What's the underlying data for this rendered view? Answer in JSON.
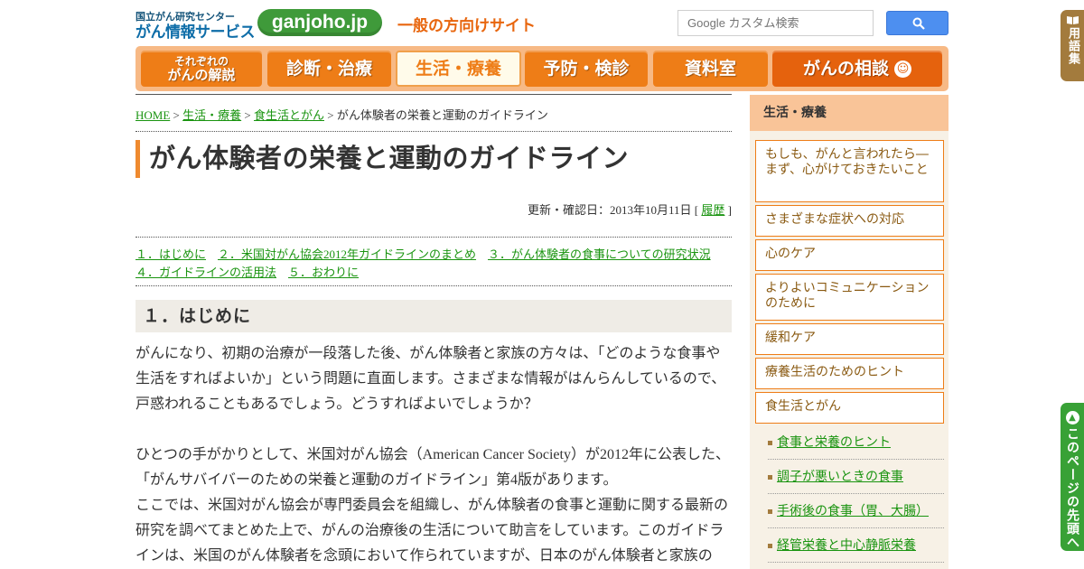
{
  "header": {
    "logo_small": "国立がん研究センター",
    "logo_big": "がん情報サービス",
    "logo_pill": "ganjoho.jp",
    "tagline": "一般の方向けサイト",
    "search_placeholder": "Google カスタム検索",
    "glossary": "用語集"
  },
  "nav": {
    "item1_small": "それぞれの",
    "item1_main": "がんの解説",
    "item2": "診断・治療",
    "item3": "生活・療養",
    "item4": "予防・検診",
    "item5": "資料室",
    "item6": "がんの相談"
  },
  "breadcrumb": {
    "home": "HOME",
    "sep1": " > ",
    "level1": "生活・療養",
    "sep2": " > ",
    "level2": "食生活とがん",
    "sep3": " > ",
    "current": "がん体験者の栄養と運動のガイドライン"
  },
  "page": {
    "title": "がん体験者の栄養と運動のガイドライン",
    "updated_prefix": "更新・確認日：2013年10月11日 [ ",
    "history_link": "履歴",
    "updated_suffix": " ]"
  },
  "toc": [
    "１．はじめに",
    "２．米国対がん協会2012年ガイドラインのまとめ",
    "３．がん体験者の食事についての研究状況",
    "４．ガイドラインの活用法",
    "５．おわりに"
  ],
  "section1": {
    "heading": "１．はじめに",
    "para1": "がんになり、初期の治療が一段落した後、がん体験者と家族の方々は、「どのような食事や生活をすればよいか」という問題に直面します。さまざまな情報がはんらんしているので、戸惑われることもあるでしょう。どうすればよいでしょうか？",
    "para2": "ひとつの手がかりとして、米国対がん協会（American Cancer Society）が2012年に公表した、「がんサバイバーのための栄養と運動のガイドライン」第4版があります。",
    "para3": "ここでは、米国対がん協会が専門委員会を組織し、がん体験者の食事と運動に関する最新の研究を調べてまとめた上で、がんの治療後の生活について助言をしています。このガイドラインは、米国のがん体験者を念頭において作られていますが、日本のがん体験者と家族の"
  },
  "sidebar": {
    "heading": "生活・療養",
    "items": [
      "もしも、がんと言われたら―まず、心がけておきたいこと",
      "さまざまな症状への対応",
      "心のケア",
      "よりよいコミュニケーションのために",
      "緩和ケア",
      "療養生活のためのヒント",
      "食生活とがん"
    ],
    "sub_items": [
      "食事と栄養のヒント",
      "調子が悪いときの食事",
      "手術後の食事（胃、大腸）",
      "経管栄養と中心静脈栄養"
    ]
  },
  "page_top": "このページの先頭へ",
  "colors": {
    "accent_orange": "#ee7d17",
    "link_green": "#1a9410",
    "brand_blue": "#0e6da8"
  }
}
